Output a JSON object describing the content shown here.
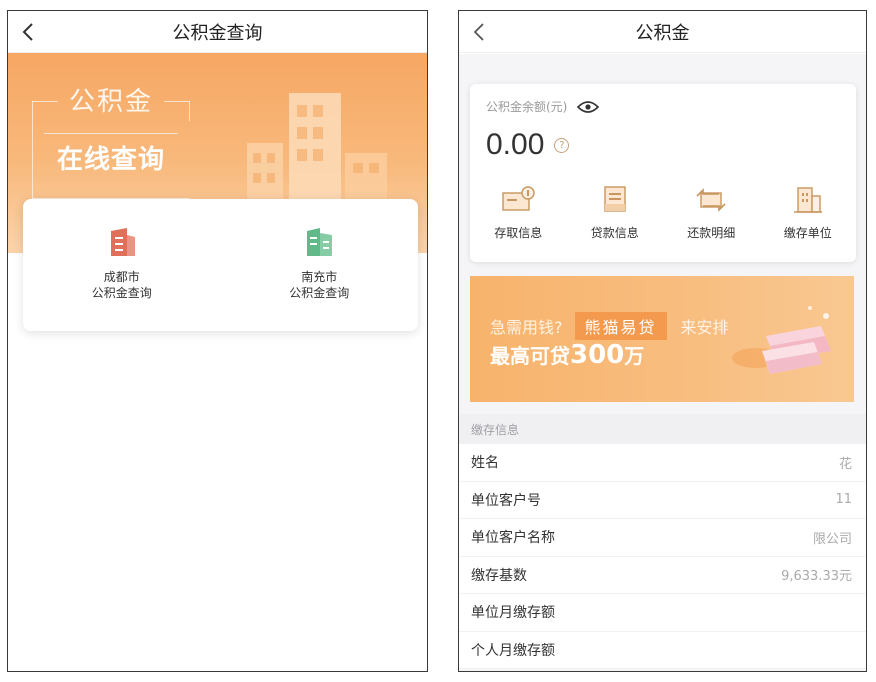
{
  "left": {
    "header": {
      "title": "公积金查询"
    },
    "hero": {
      "line1": "公积金",
      "line2": "在线查询"
    },
    "cities": [
      {
        "label1": "成都市",
        "label2": "公积金查询",
        "color": "#e0705a"
      },
      {
        "label1": "南充市",
        "label2": "公积金查询",
        "color": "#5fb989"
      }
    ]
  },
  "right": {
    "header": {
      "title": "公积金"
    },
    "balance": {
      "label": "公积金余额(元)",
      "value": "0.00"
    },
    "actions": [
      {
        "label": "存取信息",
        "icon": "deposit-withdraw-icon"
      },
      {
        "label": "贷款信息",
        "icon": "loan-document-icon"
      },
      {
        "label": "还款明细",
        "icon": "repayment-exchange-icon"
      },
      {
        "label": "缴存单位",
        "icon": "building-icon"
      }
    ],
    "banner": {
      "line1a": "急需用钱?",
      "tag": "熊猫易贷",
      "line1b": "来安排",
      "line2a": "最高可贷",
      "amount": "300",
      "unit": "万"
    },
    "section_title": "缴存信息",
    "rows": [
      {
        "key": "姓名",
        "value": "花"
      },
      {
        "key": "单位客户号",
        "value": "11"
      },
      {
        "key": "单位客户名称",
        "value": "限公司"
      },
      {
        "key": "缴存基数",
        "value": "9,633.33元"
      },
      {
        "key": "单位月缴存额",
        "value": ""
      },
      {
        "key": "个人月缴存额",
        "value": ""
      }
    ]
  },
  "colors": {
    "accent_orange": "#f6a763",
    "icon_gold": "#c8965e"
  }
}
